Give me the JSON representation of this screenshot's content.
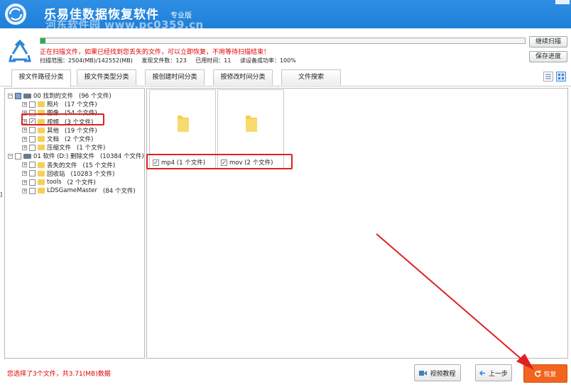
{
  "app": {
    "title": "乐易佳数据恢复软件",
    "edition": "专业版",
    "watermark": "河东软件园 www.pc0359.cn"
  },
  "scan": {
    "progress_percent": 1,
    "status_message": "正在扫描文件，如果已经找到您丢失的文件，可以立即恢复，不用等待扫描结束！",
    "range": "扫描范围：2504(MB)/142552(MB)",
    "found": "发现文件数：123",
    "elapsed": "已用时间：11",
    "success": "读设备成功率：100%",
    "continue_label": "继续扫描",
    "save_label": "保存进度"
  },
  "tabs": [
    "按文件路径分类",
    "按文件类型分类",
    "按创建时间分类",
    "按修改时间分类",
    "文件搜索"
  ],
  "active_tab": 0,
  "tree": [
    {
      "label": "00 找到的文件",
      "count": "(96 个文件)",
      "level": 0,
      "type": "disk",
      "expand": "−",
      "check": "partial"
    },
    {
      "label": "照片",
      "count": "(17 个文件)",
      "level": 1,
      "type": "folder",
      "expand": "+",
      "check": ""
    },
    {
      "label": "图像",
      "count": "(54 个文件)",
      "level": 1,
      "type": "folder",
      "expand": "+",
      "check": ""
    },
    {
      "label": "视频",
      "count": "(3 个文件)",
      "level": 1,
      "type": "folder",
      "expand": "+",
      "check": "✓"
    },
    {
      "label": "其他",
      "count": "(19 个文件)",
      "level": 1,
      "type": "folder",
      "expand": "+",
      "check": ""
    },
    {
      "label": "文档",
      "count": "(2 个文件)",
      "level": 1,
      "type": "folder",
      "expand": "+",
      "check": ""
    },
    {
      "label": "压缩文件",
      "count": "(1 个文件)",
      "level": 1,
      "type": "folder",
      "expand": "+",
      "check": ""
    },
    {
      "label": "01 软件 (D:) 删除文件",
      "count": "(10384 个文件)",
      "level": 0,
      "type": "disk",
      "expand": "−",
      "check": ""
    },
    {
      "label": "丢失的文件",
      "count": "(15 个文件)",
      "level": 1,
      "type": "folder",
      "expand": "+",
      "check": ""
    },
    {
      "label": "回收站",
      "count": "(10283 个文件)",
      "level": 1,
      "type": "folder",
      "expand": "+",
      "check": ""
    },
    {
      "label": "tools",
      "count": "(2 个文件)",
      "level": 1,
      "type": "folder",
      "expand": "+",
      "check": ""
    },
    {
      "label": "LDSGameMaster",
      "count": "(84 个文件)",
      "level": 1,
      "type": "folder",
      "expand": "+",
      "check": ""
    }
  ],
  "tiles": [
    {
      "label": "mp4 (1 个文件)",
      "check": "✓"
    },
    {
      "label": "mov (2 个文件)",
      "check": "✓"
    }
  ],
  "bottom": {
    "status": "您选择了3个文件，共3.71(MB)数据",
    "video_label": "视频教程",
    "prev_label": "上一步",
    "restore_label": "恢复"
  },
  "colors": {
    "title_bar": "#1f7fd8",
    "status_red": "#e00000",
    "progress": "#22b14c",
    "restore_button": "#f2641f",
    "highlight_box": "#e02020"
  },
  "icons": [
    "app-logo-icon",
    "recycle-icon",
    "folder-icon",
    "disk-icon",
    "video-icon",
    "prev-icon",
    "refresh-icon",
    "list-view-icon",
    "grid-view-icon"
  ]
}
